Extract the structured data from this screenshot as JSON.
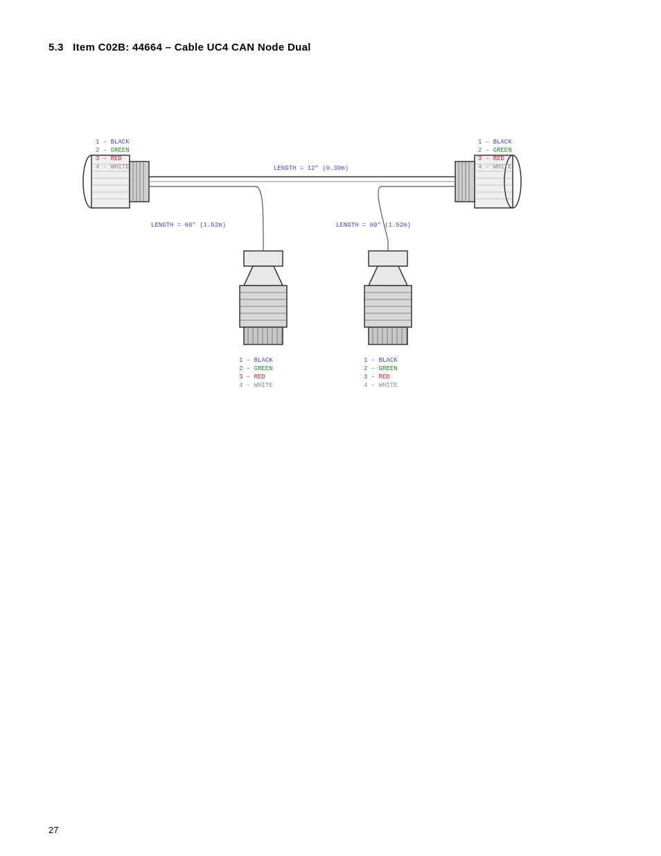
{
  "page": {
    "number": "27",
    "section": {
      "number": "5.3",
      "title": "Item C02B: 44664 – Cable UC4 CAN Node Dual"
    }
  },
  "diagram": {
    "left_connector": {
      "labels": [
        "1 – BLACK",
        "2 – GREEN",
        "3 – RED",
        "4 – WHITE"
      ]
    },
    "right_connector": {
      "labels": [
        "1 – BLACK",
        "2 – GREEN",
        "3 – RED",
        "4 – WHITE"
      ]
    },
    "bottom_left_connector": {
      "labels": [
        "1 – BLACK",
        "2 – GREEN",
        "3 – RED",
        "4 – WHITE"
      ]
    },
    "bottom_right_connector": {
      "labels": [
        "1 – BLACK",
        "2 – GREEN",
        "3 – RED",
        "4 – WHITE"
      ]
    },
    "length_top": "LENGTH = 12\" (0.30m)",
    "length_bottom_left": "LENGTH = 60\" (1.52m)",
    "length_bottom_right": "LENGTH = 60\" (1.52m)"
  }
}
